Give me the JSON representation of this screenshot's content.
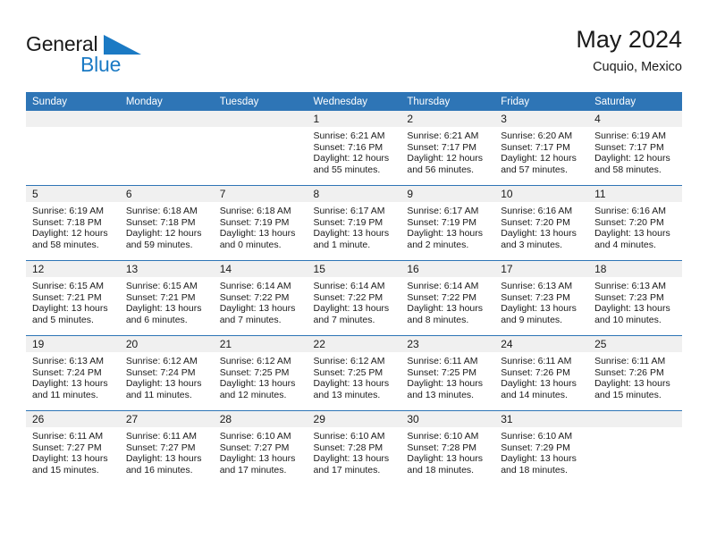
{
  "brand": {
    "name_line1": "General",
    "name_line2": "Blue",
    "triangle_color": "#1b7ac4"
  },
  "header": {
    "title": "May 2024",
    "subtitle": "Cuquio, Mexico"
  },
  "theme": {
    "header_blue": "#2e75b6",
    "daynum_band": "#f0f0f0",
    "text": "#1a1a1a"
  },
  "weekdays": [
    "Sunday",
    "Monday",
    "Tuesday",
    "Wednesday",
    "Thursday",
    "Friday",
    "Saturday"
  ],
  "weeks": [
    [
      {
        "day": "",
        "empty": true
      },
      {
        "day": "",
        "empty": true
      },
      {
        "day": "",
        "empty": true
      },
      {
        "day": "1",
        "sunrise": "Sunrise: 6:21 AM",
        "sunset": "Sunset: 7:16 PM",
        "daylight": "Daylight: 12 hours and 55 minutes."
      },
      {
        "day": "2",
        "sunrise": "Sunrise: 6:21 AM",
        "sunset": "Sunset: 7:17 PM",
        "daylight": "Daylight: 12 hours and 56 minutes."
      },
      {
        "day": "3",
        "sunrise": "Sunrise: 6:20 AM",
        "sunset": "Sunset: 7:17 PM",
        "daylight": "Daylight: 12 hours and 57 minutes."
      },
      {
        "day": "4",
        "sunrise": "Sunrise: 6:19 AM",
        "sunset": "Sunset: 7:17 PM",
        "daylight": "Daylight: 12 hours and 58 minutes."
      }
    ],
    [
      {
        "day": "5",
        "sunrise": "Sunrise: 6:19 AM",
        "sunset": "Sunset: 7:18 PM",
        "daylight": "Daylight: 12 hours and 58 minutes."
      },
      {
        "day": "6",
        "sunrise": "Sunrise: 6:18 AM",
        "sunset": "Sunset: 7:18 PM",
        "daylight": "Daylight: 12 hours and 59 minutes."
      },
      {
        "day": "7",
        "sunrise": "Sunrise: 6:18 AM",
        "sunset": "Sunset: 7:19 PM",
        "daylight": "Daylight: 13 hours and 0 minutes."
      },
      {
        "day": "8",
        "sunrise": "Sunrise: 6:17 AM",
        "sunset": "Sunset: 7:19 PM",
        "daylight": "Daylight: 13 hours and 1 minute."
      },
      {
        "day": "9",
        "sunrise": "Sunrise: 6:17 AM",
        "sunset": "Sunset: 7:19 PM",
        "daylight": "Daylight: 13 hours and 2 minutes."
      },
      {
        "day": "10",
        "sunrise": "Sunrise: 6:16 AM",
        "sunset": "Sunset: 7:20 PM",
        "daylight": "Daylight: 13 hours and 3 minutes."
      },
      {
        "day": "11",
        "sunrise": "Sunrise: 6:16 AM",
        "sunset": "Sunset: 7:20 PM",
        "daylight": "Daylight: 13 hours and 4 minutes."
      }
    ],
    [
      {
        "day": "12",
        "sunrise": "Sunrise: 6:15 AM",
        "sunset": "Sunset: 7:21 PM",
        "daylight": "Daylight: 13 hours and 5 minutes."
      },
      {
        "day": "13",
        "sunrise": "Sunrise: 6:15 AM",
        "sunset": "Sunset: 7:21 PM",
        "daylight": "Daylight: 13 hours and 6 minutes."
      },
      {
        "day": "14",
        "sunrise": "Sunrise: 6:14 AM",
        "sunset": "Sunset: 7:22 PM",
        "daylight": "Daylight: 13 hours and 7 minutes."
      },
      {
        "day": "15",
        "sunrise": "Sunrise: 6:14 AM",
        "sunset": "Sunset: 7:22 PM",
        "daylight": "Daylight: 13 hours and 7 minutes."
      },
      {
        "day": "16",
        "sunrise": "Sunrise: 6:14 AM",
        "sunset": "Sunset: 7:22 PM",
        "daylight": "Daylight: 13 hours and 8 minutes."
      },
      {
        "day": "17",
        "sunrise": "Sunrise: 6:13 AM",
        "sunset": "Sunset: 7:23 PM",
        "daylight": "Daylight: 13 hours and 9 minutes."
      },
      {
        "day": "18",
        "sunrise": "Sunrise: 6:13 AM",
        "sunset": "Sunset: 7:23 PM",
        "daylight": "Daylight: 13 hours and 10 minutes."
      }
    ],
    [
      {
        "day": "19",
        "sunrise": "Sunrise: 6:13 AM",
        "sunset": "Sunset: 7:24 PM",
        "daylight": "Daylight: 13 hours and 11 minutes."
      },
      {
        "day": "20",
        "sunrise": "Sunrise: 6:12 AM",
        "sunset": "Sunset: 7:24 PM",
        "daylight": "Daylight: 13 hours and 11 minutes."
      },
      {
        "day": "21",
        "sunrise": "Sunrise: 6:12 AM",
        "sunset": "Sunset: 7:25 PM",
        "daylight": "Daylight: 13 hours and 12 minutes."
      },
      {
        "day": "22",
        "sunrise": "Sunrise: 6:12 AM",
        "sunset": "Sunset: 7:25 PM",
        "daylight": "Daylight: 13 hours and 13 minutes."
      },
      {
        "day": "23",
        "sunrise": "Sunrise: 6:11 AM",
        "sunset": "Sunset: 7:25 PM",
        "daylight": "Daylight: 13 hours and 13 minutes."
      },
      {
        "day": "24",
        "sunrise": "Sunrise: 6:11 AM",
        "sunset": "Sunset: 7:26 PM",
        "daylight": "Daylight: 13 hours and 14 minutes."
      },
      {
        "day": "25",
        "sunrise": "Sunrise: 6:11 AM",
        "sunset": "Sunset: 7:26 PM",
        "daylight": "Daylight: 13 hours and 15 minutes."
      }
    ],
    [
      {
        "day": "26",
        "sunrise": "Sunrise: 6:11 AM",
        "sunset": "Sunset: 7:27 PM",
        "daylight": "Daylight: 13 hours and 15 minutes."
      },
      {
        "day": "27",
        "sunrise": "Sunrise: 6:11 AM",
        "sunset": "Sunset: 7:27 PM",
        "daylight": "Daylight: 13 hours and 16 minutes."
      },
      {
        "day": "28",
        "sunrise": "Sunrise: 6:10 AM",
        "sunset": "Sunset: 7:27 PM",
        "daylight": "Daylight: 13 hours and 17 minutes."
      },
      {
        "day": "29",
        "sunrise": "Sunrise: 6:10 AM",
        "sunset": "Sunset: 7:28 PM",
        "daylight": "Daylight: 13 hours and 17 minutes."
      },
      {
        "day": "30",
        "sunrise": "Sunrise: 6:10 AM",
        "sunset": "Sunset: 7:28 PM",
        "daylight": "Daylight: 13 hours and 18 minutes."
      },
      {
        "day": "31",
        "sunrise": "Sunrise: 6:10 AM",
        "sunset": "Sunset: 7:29 PM",
        "daylight": "Daylight: 13 hours and 18 minutes."
      },
      {
        "day": "",
        "empty": true
      }
    ]
  ]
}
